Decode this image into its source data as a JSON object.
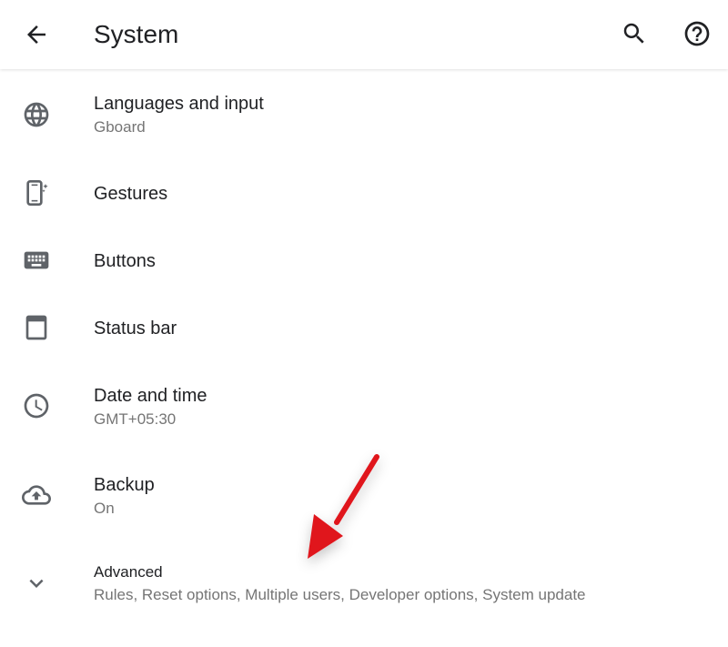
{
  "header": {
    "title": "System"
  },
  "items": [
    {
      "label": "Languages and input",
      "summary": "Gboard",
      "icon": "globe-icon"
    },
    {
      "label": "Gestures",
      "icon": "phone-gesture-icon"
    },
    {
      "label": "Buttons",
      "icon": "keyboard-icon"
    },
    {
      "label": "Status bar",
      "icon": "status-bar-icon"
    },
    {
      "label": "Date and time",
      "summary": "GMT+05:30",
      "icon": "clock-icon"
    },
    {
      "label": "Backup",
      "summary": "On",
      "icon": "cloud-upload-icon"
    },
    {
      "label": "Advanced",
      "summary": "Rules, Reset options, Multiple users, Developer options, System update",
      "icon": "chevron-down-icon"
    }
  ],
  "colors": {
    "icon": "#5f6368",
    "primary_text": "#202124",
    "secondary_text": "#757575",
    "annotation_arrow": "#e0141e"
  }
}
